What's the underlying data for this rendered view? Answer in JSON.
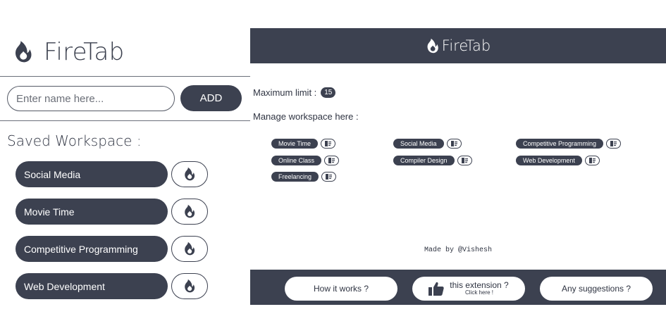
{
  "popup": {
    "title": "FireTab",
    "input_placeholder": "Enter name here...",
    "add_label": "ADD",
    "saved_title": "Saved Workspace :",
    "workspaces": [
      {
        "label": "Social Media"
      },
      {
        "label": "Movie Time"
      },
      {
        "label": "Competitive Programming"
      },
      {
        "label": "Web Development"
      }
    ]
  },
  "newtab": {
    "title": "FireTab",
    "limit_label": "Maximum limit :",
    "limit_value": "15",
    "manage_label": "Manage workspace here :",
    "chips": [
      {
        "label": "Movie Time"
      },
      {
        "label": "Online Class"
      },
      {
        "label": "Freelancing"
      },
      {
        "label": "Social Media"
      },
      {
        "label": "Compiler Design"
      },
      {
        "label": "Competitive Programming"
      },
      {
        "label": "Web Development"
      }
    ],
    "credit": "Made by @Vishesh",
    "footer": {
      "how_it_works": "How it works ?",
      "like_main": "this extension ?",
      "like_sub": "Click here !",
      "suggestions": "Any suggestions ?"
    }
  },
  "colors": {
    "primary": "#3c4150",
    "background": "#ffffff"
  },
  "icons": {
    "brand": "flame-icon",
    "workspace_action": "flame-icon",
    "chip_delete": "trash-icon",
    "like": "thumbs-up-icon"
  }
}
